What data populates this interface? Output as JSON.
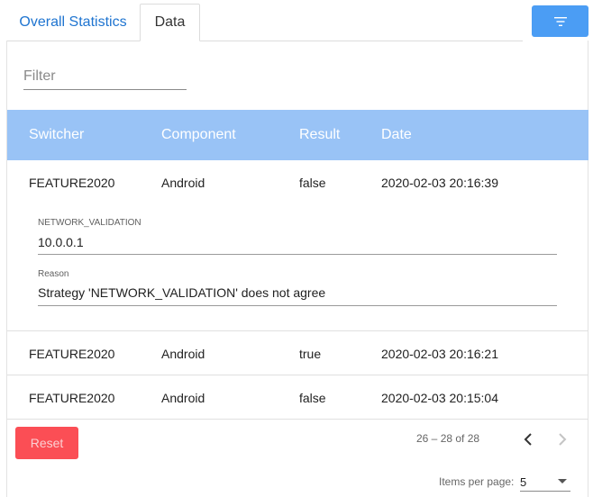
{
  "tabs": [
    {
      "label": "Overall Statistics",
      "active": false
    },
    {
      "label": "Data",
      "active": true
    }
  ],
  "toolbar": {
    "filter_icon": "filter-list-icon",
    "accent_color": "#4b9df4"
  },
  "filter": {
    "placeholder": "Filter",
    "value": ""
  },
  "table": {
    "columns": [
      "Switcher",
      "Component",
      "Result",
      "Date"
    ],
    "header_color": "#99c3f6",
    "rows": [
      {
        "switcher": "FEATURE2020",
        "component": "Android",
        "result": "false",
        "date": "2020-02-03 20:16:39",
        "expanded": true,
        "details": [
          {
            "label": "NETWORK_VALIDATION",
            "value": "10.0.0.1"
          },
          {
            "label": "Reason",
            "value": "Strategy 'NETWORK_VALIDATION' does not agree"
          }
        ]
      },
      {
        "switcher": "FEATURE2020",
        "component": "Android",
        "result": "true",
        "date": "2020-02-03 20:16:21"
      },
      {
        "switcher": "FEATURE2020",
        "component": "Android",
        "result": "false",
        "date": "2020-02-03 20:15:04"
      }
    ]
  },
  "footer": {
    "reset_label": "Reset",
    "reset_color": "#fb4e55",
    "range_label": "26 – 28 of 28",
    "items_per_page_label": "Items per page:",
    "items_per_page_value": "5"
  }
}
